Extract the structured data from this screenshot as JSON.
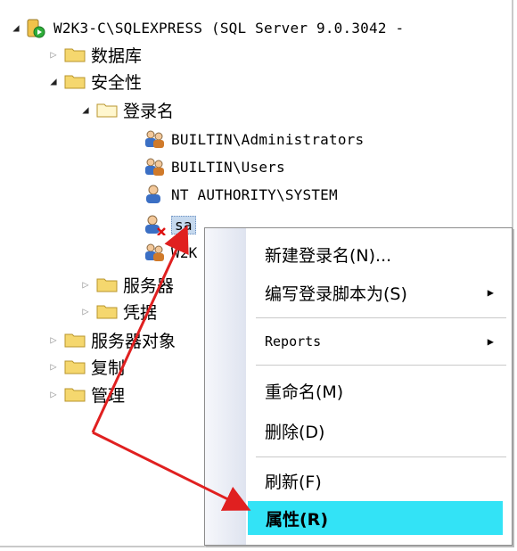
{
  "tree": {
    "server": "W2K3-C\\SQLEXPRESS (SQL Server 9.0.3042 -",
    "databases": "数据库",
    "security": "安全性",
    "logins": "登录名",
    "login_items": [
      "BUILTIN\\Administrators",
      "BUILTIN\\Users",
      "NT AUTHORITY\\SYSTEM",
      "sa",
      "W2K"
    ],
    "server_roles": "服务器",
    "credentials": "凭据",
    "server_objects": "服务器对象",
    "replication": "复制",
    "management": "管理"
  },
  "context_menu": {
    "items": [
      {
        "label": "新建登录名(N)...",
        "submenu": false
      },
      {
        "label": "编写登录脚本为(S)",
        "submenu": true
      },
      {
        "label": "Reports",
        "submenu": true
      },
      {
        "label": "重命名(M)",
        "submenu": false
      },
      {
        "label": "删除(D)",
        "submenu": false
      },
      {
        "label": "刷新(F)",
        "submenu": false
      },
      {
        "label": "属性(R)",
        "submenu": false,
        "highlighted": true
      }
    ]
  },
  "annotation_color": "#e02020",
  "highlight_color": "#33e3f6"
}
